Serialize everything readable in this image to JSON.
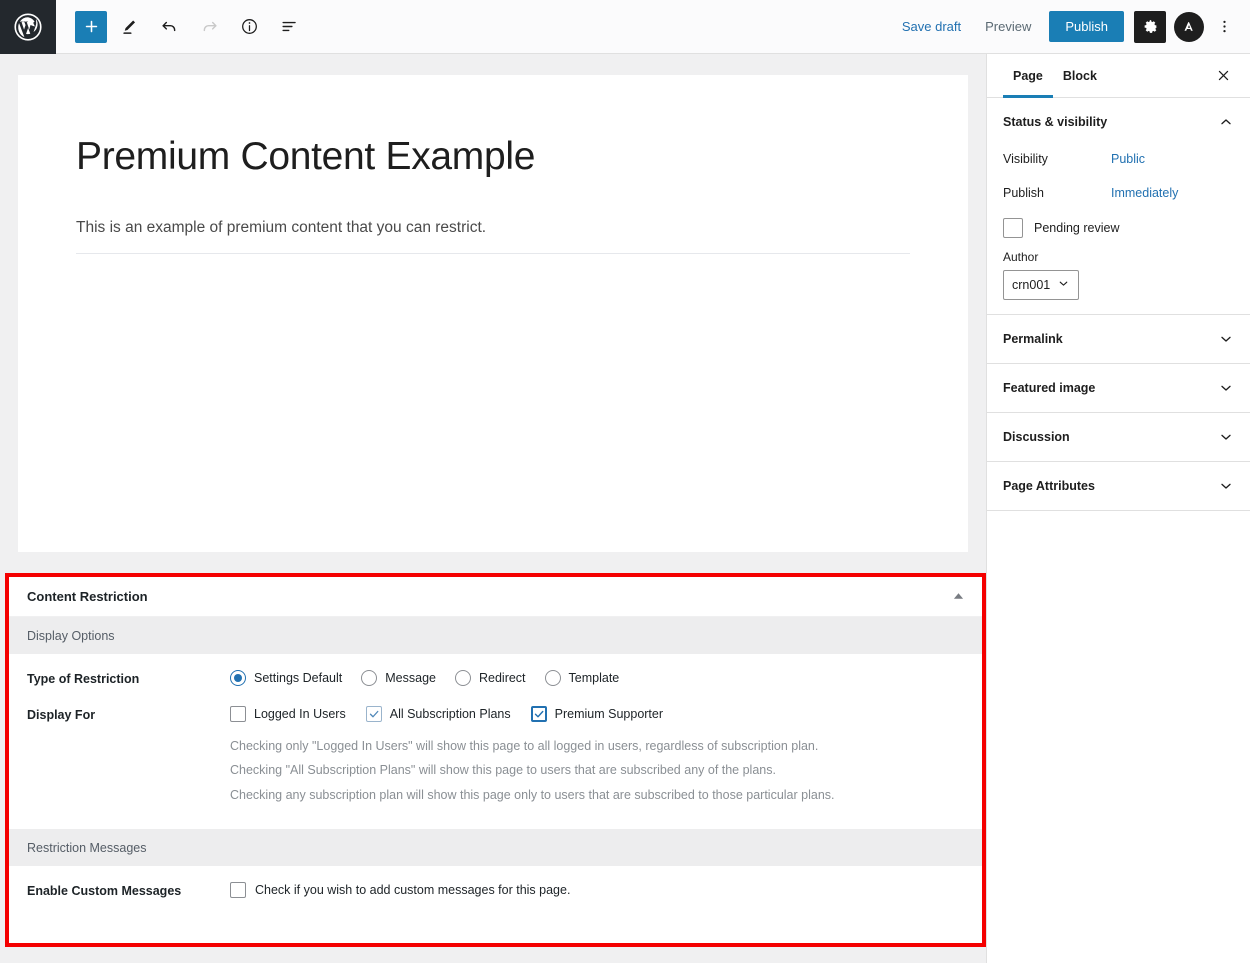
{
  "topbar": {
    "logo_icon": "wordpress-logo-icon",
    "add_block_icon": "plus-icon",
    "tools_icon": "pencil-icon",
    "undo_icon": "undo-arrow-icon",
    "redo_icon": "redo-arrow-icon",
    "info_icon": "info-circle-icon",
    "list_view_icon": "list-view-icon",
    "save_draft_label": "Save draft",
    "preview_label": "Preview",
    "publish_label": "Publish",
    "settings_icon": "gear-icon",
    "plugin_icon": "plugin-avatar-icon",
    "options_icon": "kebab-menu-icon"
  },
  "editor": {
    "title": "Premium Content Example",
    "paragraph": "This is an example of premium content that you can restrict."
  },
  "sidebar": {
    "tabs": [
      {
        "label": "Page",
        "active": true
      },
      {
        "label": "Block",
        "active": false
      }
    ],
    "close_icon": "close-icon",
    "status_visibility": {
      "title": "Status & visibility",
      "collapse_icon": "chevron-up-icon",
      "visibility_label": "Visibility",
      "visibility_value": "Public",
      "publish_label": "Publish",
      "publish_value": "Immediately",
      "pending_review_label": "Pending review",
      "pending_review_checked": false,
      "author_label": "Author",
      "author_value": "crn001",
      "author_dropdown_icon": "chevron-down-icon"
    },
    "panels": [
      {
        "label": "Permalink",
        "icon": "chevron-down-icon"
      },
      {
        "label": "Featured image",
        "icon": "chevron-down-icon"
      },
      {
        "label": "Discussion",
        "icon": "chevron-down-icon"
      },
      {
        "label": "Page Attributes",
        "icon": "chevron-down-icon"
      }
    ]
  },
  "metabox": {
    "title": "Content Restriction",
    "toggle_icon": "triangle-up-icon",
    "highlight_color": "#f40000",
    "section_display_options": "Display Options",
    "type_of_restriction_label": "Type of Restriction",
    "restriction_options": [
      {
        "label": "Settings Default",
        "checked": true
      },
      {
        "label": "Message",
        "checked": false
      },
      {
        "label": "Redirect",
        "checked": false
      },
      {
        "label": "Template",
        "checked": false
      }
    ],
    "display_for_label": "Display For",
    "display_for_options": [
      {
        "label": "Logged In Users",
        "checked": false,
        "emphasis": false
      },
      {
        "label": "All Subscription Plans",
        "checked": true,
        "emphasis": false
      },
      {
        "label": "Premium Supporter",
        "checked": true,
        "emphasis": true
      }
    ],
    "help_lines": [
      "Checking only \"Logged In Users\" will show this page to all logged in users, regardless of subscription plan.",
      "Checking \"All Subscription Plans\" will show this page to users that are subscribed any of the plans.",
      "Checking any subscription plan will show this page only to users that are subscribed to those particular plans."
    ],
    "section_restriction_messages": "Restriction Messages",
    "enable_custom_messages_label": "Enable Custom Messages",
    "enable_custom_messages_text": "Check if you wish to add custom messages for this page.",
    "enable_custom_messages_checked": false
  }
}
